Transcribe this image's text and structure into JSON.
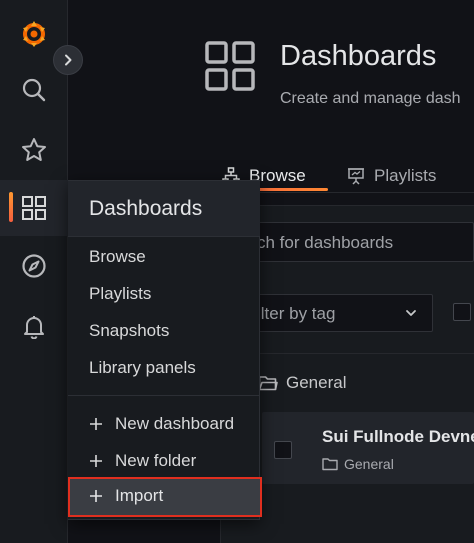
{
  "sidebar": {
    "icons": [
      "grafana-logo",
      "search-icon",
      "star-icon",
      "dashboards-grid-icon",
      "explore-compass-icon",
      "alerting-bell-icon"
    ],
    "brand_colors": {
      "logo_orange": "#f46800",
      "active_gradient": [
        "#ff9830",
        "#f55f3e"
      ]
    }
  },
  "header": {
    "title": "Dashboards",
    "subtitle": "Create and manage dash"
  },
  "tabs": [
    {
      "label": "Browse",
      "active": true,
      "icon": "sitemap-icon"
    },
    {
      "label": "Playlists",
      "active": false,
      "icon": "presentation-icon"
    }
  ],
  "search": {
    "placeholder": "ch for dashboards"
  },
  "tag_filter": {
    "placeholder": "ilter by tag"
  },
  "folder": {
    "name": "General"
  },
  "dashboard_row": {
    "title": "Sui Fullnode Devnet",
    "folder": "General"
  },
  "flyout": {
    "header": "Dashboards",
    "items": [
      "Browse",
      "Playlists",
      "Snapshots",
      "Library panels"
    ],
    "actions": [
      "New dashboard",
      "New folder",
      "Import"
    ],
    "highlight_color": "#e02f1f"
  }
}
